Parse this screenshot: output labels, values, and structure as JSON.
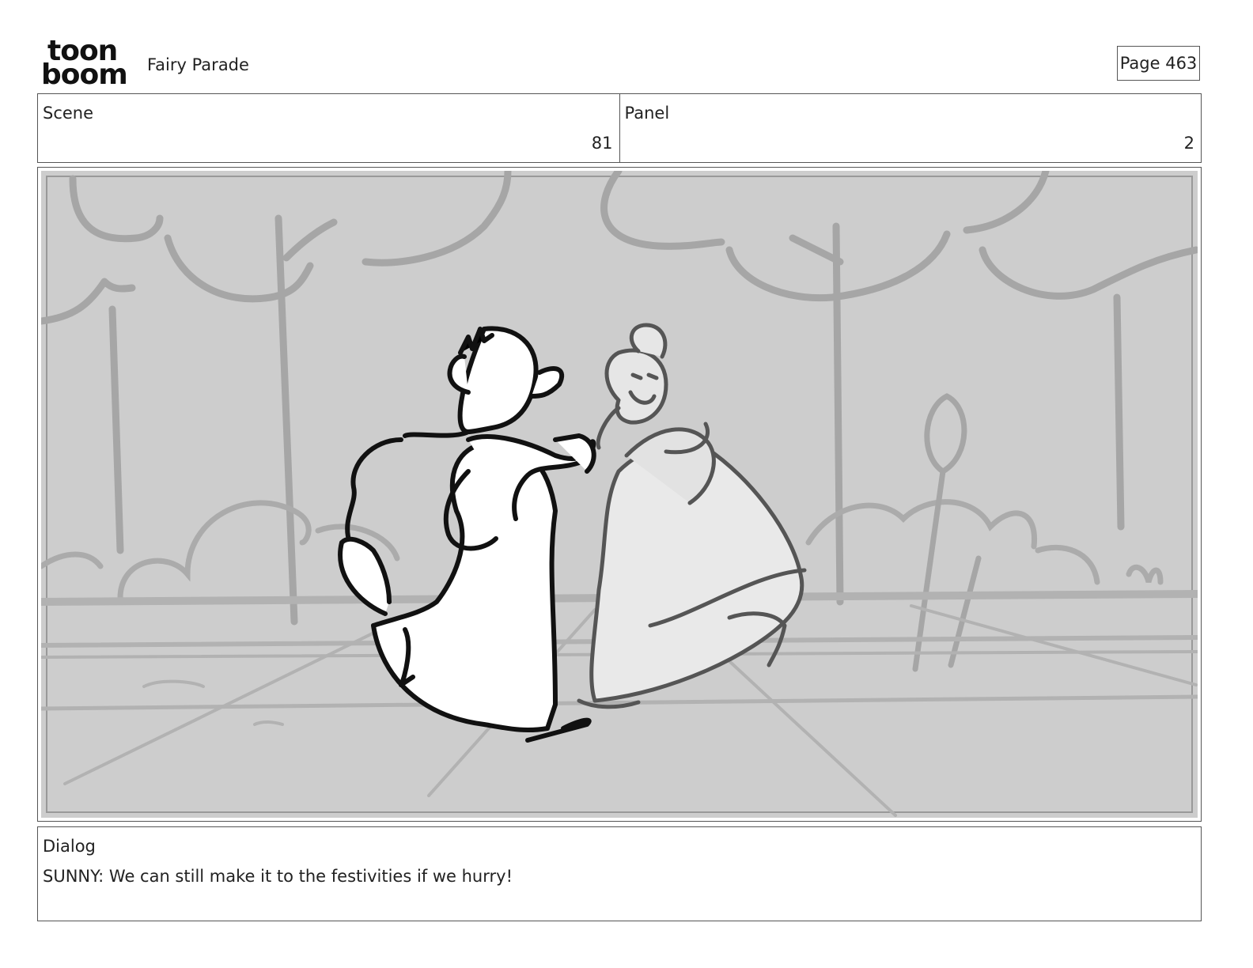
{
  "header": {
    "logo_top": "toon",
    "logo_bottom": "boom",
    "project_title": "Fairy Parade",
    "page_label": "Page 463"
  },
  "info": {
    "scene_label": "Scene",
    "scene_value": "81",
    "panel_label": "Panel",
    "panel_value": "2"
  },
  "dialog": {
    "label": "Dialog",
    "text": "SUNNY: We can still make it to the festivities if we hurry!"
  }
}
